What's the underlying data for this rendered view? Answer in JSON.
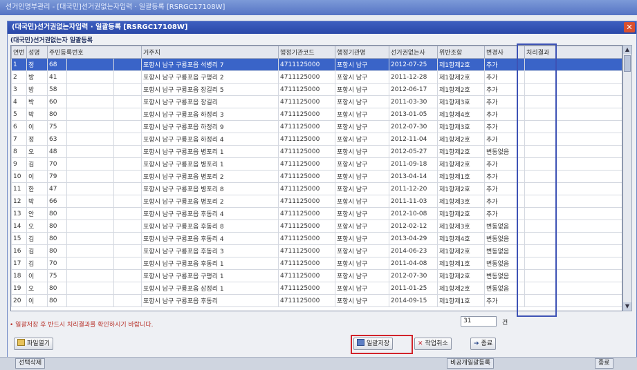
{
  "window": {
    "outer_title": "선거인명부관리 - [대국민]선거권없는자입력 · 일괄등록 [RSRGC17108W]",
    "dialog_title": "(대국민)선거권없는자입력 · 일괄등록 [RSRGC17108W]",
    "section_title": "(대국민)선거권없는자 일괄등록"
  },
  "columns": [
    "연번",
    "성명",
    "주민등록번호",
    "거주지",
    "행정기관코드",
    "행정기관명",
    "선거권없는사",
    "위반조항",
    "변경사",
    "처리결과"
  ],
  "rows": [
    {
      "no": "1",
      "name": "정",
      "rrn": "68",
      "addr": "포항시 남구 구룡포읍 석병리 7",
      "code": "4711125000",
      "org": "포항시 남구",
      "date": "2012-07-25",
      "law": "제1항제2호",
      "change": "추가",
      "result": ""
    },
    {
      "no": "2",
      "name": "방",
      "rrn": "41",
      "addr": "포항시 남구 구룡포읍 구평리 2",
      "code": "4711125000",
      "org": "포항시 남구",
      "date": "2011-12-28",
      "law": "제1항제2호",
      "change": "추가",
      "result": ""
    },
    {
      "no": "3",
      "name": "방",
      "rrn": "58",
      "addr": "포항시 남구 구룡포읍 장길리 5",
      "code": "4711125000",
      "org": "포항시 남구",
      "date": "2012-06-17",
      "law": "제1항제2호",
      "change": "추가",
      "result": ""
    },
    {
      "no": "4",
      "name": "박",
      "rrn": "60",
      "addr": "포항시 남구 구룡포읍 장길리",
      "code": "4711125000",
      "org": "포항시 남구",
      "date": "2011-03-30",
      "law": "제1항제3호",
      "change": "추가",
      "result": ""
    },
    {
      "no": "5",
      "name": "박",
      "rrn": "80",
      "addr": "포항시 남구 구룡포읍 하정리 3",
      "code": "4711125000",
      "org": "포항시 남구",
      "date": "2013-01-05",
      "law": "제1항제4호",
      "change": "추가",
      "result": ""
    },
    {
      "no": "6",
      "name": "이",
      "rrn": "75",
      "addr": "포항시 남구 구룡포읍 하정리 9",
      "code": "4711125000",
      "org": "포항시 남구",
      "date": "2012-07-30",
      "law": "제1항제3호",
      "change": "추가",
      "result": ""
    },
    {
      "no": "7",
      "name": "정",
      "rrn": "63",
      "addr": "포항시 남구 구룡포읍 하정리 4",
      "code": "4711125000",
      "org": "포항시 남구",
      "date": "2012-11-04",
      "law": "제1항제2호",
      "change": "추가",
      "result": ""
    },
    {
      "no": "8",
      "name": "오",
      "rrn": "48",
      "addr": "포항시 남구 구룡포읍 병포리 1",
      "code": "4711125000",
      "org": "포항시 남구",
      "date": "2012-05-27",
      "law": "제1항제2호",
      "change": "변동없음",
      "result": ""
    },
    {
      "no": "9",
      "name": "김",
      "rrn": "70",
      "addr": "포항시 남구 구룡포읍 병포리 1",
      "code": "4711125000",
      "org": "포항시 남구",
      "date": "2011-09-18",
      "law": "제1항제2호",
      "change": "추가",
      "result": ""
    },
    {
      "no": "10",
      "name": "이",
      "rrn": "79",
      "addr": "포항시 남구 구룡포읍 병포리 2",
      "code": "4711125000",
      "org": "포항시 남구",
      "date": "2013-04-14",
      "law": "제1항제1호",
      "change": "추가",
      "result": ""
    },
    {
      "no": "11",
      "name": "한",
      "rrn": "47",
      "addr": "포항시 남구 구룡포읍 병포리 8",
      "code": "4711125000",
      "org": "포항시 남구",
      "date": "2011-12-20",
      "law": "제1항제2호",
      "change": "추가",
      "result": ""
    },
    {
      "no": "12",
      "name": "박",
      "rrn": "66",
      "addr": "포항시 남구 구룡포읍 병포리 2",
      "code": "4711125000",
      "org": "포항시 남구",
      "date": "2011-11-03",
      "law": "제1항제3호",
      "change": "추가",
      "result": ""
    },
    {
      "no": "13",
      "name": "안",
      "rrn": "80",
      "addr": "포항시 남구 구룡포읍 후동리 4",
      "code": "4711125000",
      "org": "포항시 남구",
      "date": "2012-10-08",
      "law": "제1항제2호",
      "change": "추가",
      "result": ""
    },
    {
      "no": "14",
      "name": "오",
      "rrn": "80",
      "addr": "포항시 남구 구룡포읍 후동리 8",
      "code": "4711125000",
      "org": "포항시 남구",
      "date": "2012-02-12",
      "law": "제1항제3호",
      "change": "변동없음",
      "result": ""
    },
    {
      "no": "15",
      "name": "김",
      "rrn": "80",
      "addr": "포항시 남구 구룡포읍 후동리 4",
      "code": "4711125000",
      "org": "포항시 남구",
      "date": "2013-04-29",
      "law": "제1항제4호",
      "change": "변동없음",
      "result": ""
    },
    {
      "no": "16",
      "name": "김",
      "rrn": "80",
      "addr": "포항시 남구 구룡포읍 후동리 3",
      "code": "4711125000",
      "org": "포항시 남구",
      "date": "2014-06-23",
      "law": "제1항제2호",
      "change": "변동없음",
      "result": ""
    },
    {
      "no": "17",
      "name": "김",
      "rrn": "70",
      "addr": "포항시 남구 구룡포읍 후동리 1",
      "code": "4711125000",
      "org": "포항시 남구",
      "date": "2011-04-08",
      "law": "제1항제1호",
      "change": "변동없음",
      "result": ""
    },
    {
      "no": "18",
      "name": "이",
      "rrn": "75",
      "addr": "포항시 남구 구룡포읍 구평리 1",
      "code": "4711125000",
      "org": "포항시 남구",
      "date": "2012-07-30",
      "law": "제1항제2호",
      "change": "변동없음",
      "result": ""
    },
    {
      "no": "19",
      "name": "오",
      "rrn": "80",
      "addr": "포항시 남구 구룡포읍 삼정리 1",
      "code": "4711125000",
      "org": "포항시 남구",
      "date": "2011-01-25",
      "law": "제1항제2호",
      "change": "변동없음",
      "result": ""
    },
    {
      "no": "20",
      "name": "이",
      "rrn": "80",
      "addr": "포항시 남구 구룡포읍 후동리",
      "code": "4711125000",
      "org": "포항시 남구",
      "date": "2014-09-15",
      "law": "제1항제1호",
      "change": "추가",
      "result": ""
    }
  ],
  "footer": {
    "notice": "• 일괄저장 후 반드시 처리결과를 확인하시기 바랍니다.",
    "count_value": "31",
    "count_unit": "건",
    "open_file_label": "파일열기",
    "save_all_label": "일괄저장",
    "cancel_label": "작업취소",
    "exit_label": "종료"
  },
  "taskbar": {
    "left_label": "선택삭제",
    "mid_label": "비공개일괄등록",
    "right_label": "종료"
  },
  "colors": {
    "selection": "#3a64c8",
    "highlight_border": "#3d52b5",
    "save_highlight": "#d2232a"
  }
}
